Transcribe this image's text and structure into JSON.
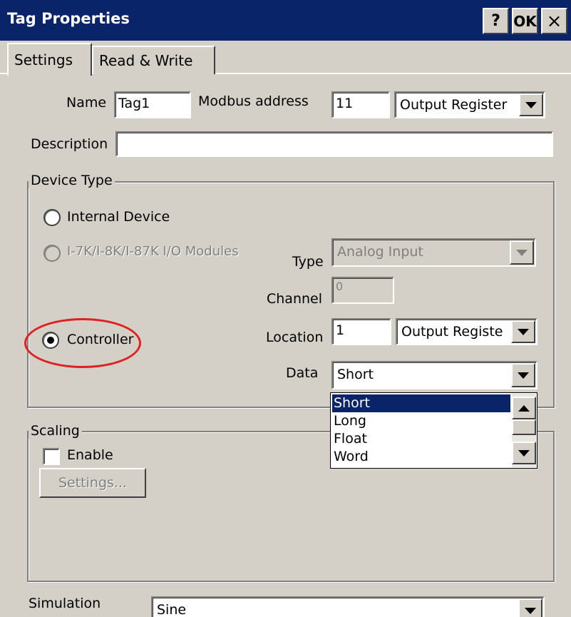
{
  "window": {
    "title": "Tag Properties",
    "help_label": "?",
    "ok_label": "OK",
    "close_label": "×"
  },
  "tabs": [
    {
      "label": "Settings"
    },
    {
      "label": "Read & Write"
    }
  ],
  "form": {
    "name_label": "Name",
    "name_value": "Tag1",
    "modbus_label": "Modbus address",
    "modbus_value": "11",
    "modbus_type": "Output Register",
    "description_label": "Description",
    "description_value": ""
  },
  "device_type": {
    "legend": "Device Type",
    "options": [
      {
        "label": "Internal Device",
        "selected": false,
        "enabled": true
      },
      {
        "label": "I-7K/I-8K/I-87K I/O Modules",
        "selected": false,
        "enabled": false
      },
      {
        "label": "Controller",
        "selected": true,
        "enabled": true
      }
    ],
    "type_label": "Type",
    "type_value": "Analog Input",
    "channel_label": "Channel",
    "channel_value": "0",
    "location_label": "Location",
    "location_value": "1",
    "location_type": "Output Registe",
    "data_label": "Data",
    "data_value": "Short",
    "data_options": [
      "Short",
      "Long",
      "Float",
      "Word"
    ],
    "data_selected": "Short"
  },
  "scaling": {
    "legend": "Scaling",
    "enable_label": "Enable",
    "enable_checked": false,
    "settings_label": "Settings..."
  },
  "simulation": {
    "label": "Simulation",
    "value": "Sine"
  },
  "colors": {
    "titlebar": "#0a246a",
    "face": "#d4d0c8",
    "selection": "#0a246a",
    "annotation": "#e02020"
  }
}
